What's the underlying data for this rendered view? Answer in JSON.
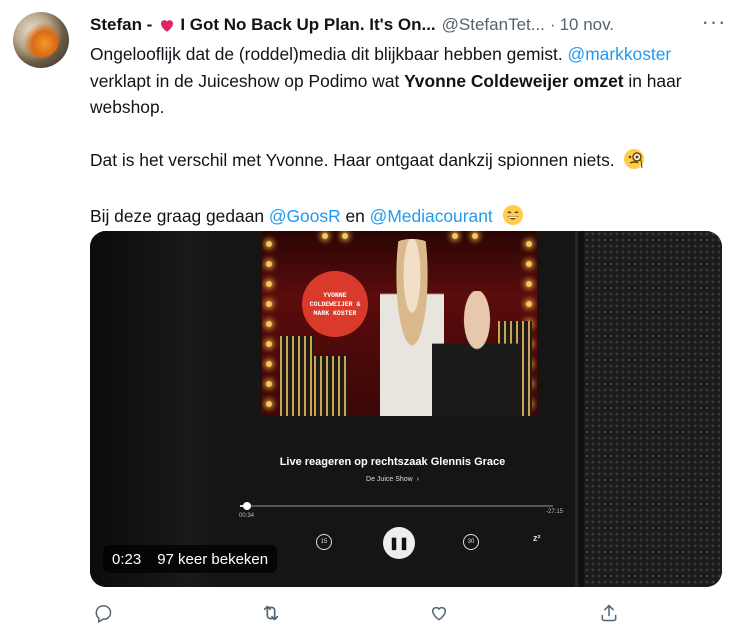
{
  "tweet": {
    "display_name": "Stefan - ",
    "name_suffix": "I Got No Back Up Plan. It's On...",
    "handle": "@StefanTet...",
    "dot": "·",
    "date": "10 nov.",
    "more_label": "···",
    "text": {
      "l1_a": "Ongelooflijk dat de (roddel)media dit blijkbaar hebben gemist. ",
      "l1_mention": "@markkoster",
      "l2_a": "verklapt in de Juiceshow op Podimo wat ",
      "l2_bold": "Yvonne Coldeweijer omzet",
      "l2_b": " in haar webshop.",
      "p2": "Dat is het verschil met Yvonne. Haar ontgaat dankzij spionnen niets.",
      "p3_a": "Bij deze graag gedaan ",
      "p3_mention1": "@GoosR",
      "p3_mid": " en ",
      "p3_mention2": "@Mediacourant"
    }
  },
  "media": {
    "badge_text": "YVONNE COLDEWEIJER & MARK KOSTER",
    "episode_title": "Live reageren op rechtszaak Glennis Grace",
    "show_name": "De Juice Show",
    "chevron": "›",
    "elapsed": "00:34",
    "remaining": "-27:15",
    "skip_back": "15",
    "skip_fwd": "30",
    "sleep": "z²",
    "play_icon": "❚❚",
    "overlay_duration": "0:23",
    "overlay_views": "97 keer bekeken"
  },
  "colors": {
    "link": "#1d9bf0",
    "secondary": "#536471",
    "heart": "#f91880"
  },
  "icons": [
    "reply-icon",
    "retweet-icon",
    "like-icon",
    "share-icon"
  ]
}
